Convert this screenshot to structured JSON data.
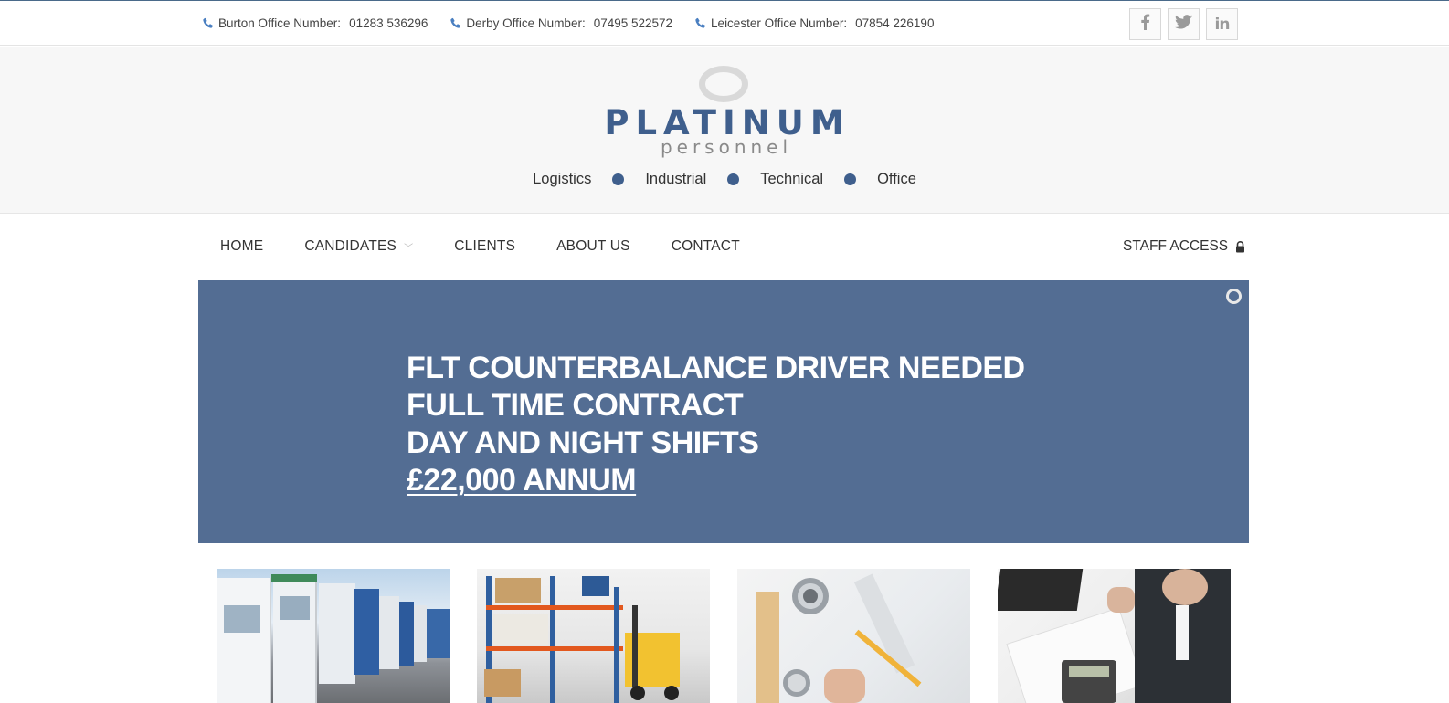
{
  "topbar": {
    "phones": [
      {
        "label": "Burton Office Number:",
        "number": "01283 536296"
      },
      {
        "label": "Derby Office Number:",
        "number": "07495 522572"
      },
      {
        "label": "Leicester Office Number:",
        "number": "07854 226190"
      }
    ],
    "socials": [
      {
        "icon": "facebook-icon",
        "glyph": "f"
      },
      {
        "icon": "twitter-icon",
        "glyph": "t"
      },
      {
        "icon": "linkedin-icon",
        "glyph": "in"
      }
    ]
  },
  "logo": {
    "main": "PLATINUM",
    "sub": "personnel"
  },
  "sectors": [
    "Logistics",
    "Industrial",
    "Technical",
    "Office"
  ],
  "nav": {
    "items": [
      "HOME",
      "CANDIDATES",
      "CLIENTS",
      "ABOUT US",
      "CONTACT"
    ],
    "staff_access": "STAFF ACCESS"
  },
  "banner": {
    "lines": [
      "FLT COUNTERBALANCE DRIVER NEEDED",
      "FULL TIME CONTRACT",
      "DAY AND NIGHT SHIFTS"
    ],
    "salary": "£22,000 ANNUM"
  },
  "colors": {
    "brand": "#3f5f8d",
    "banner": "#536d93",
    "phone_icon": "#4a7fc1"
  }
}
